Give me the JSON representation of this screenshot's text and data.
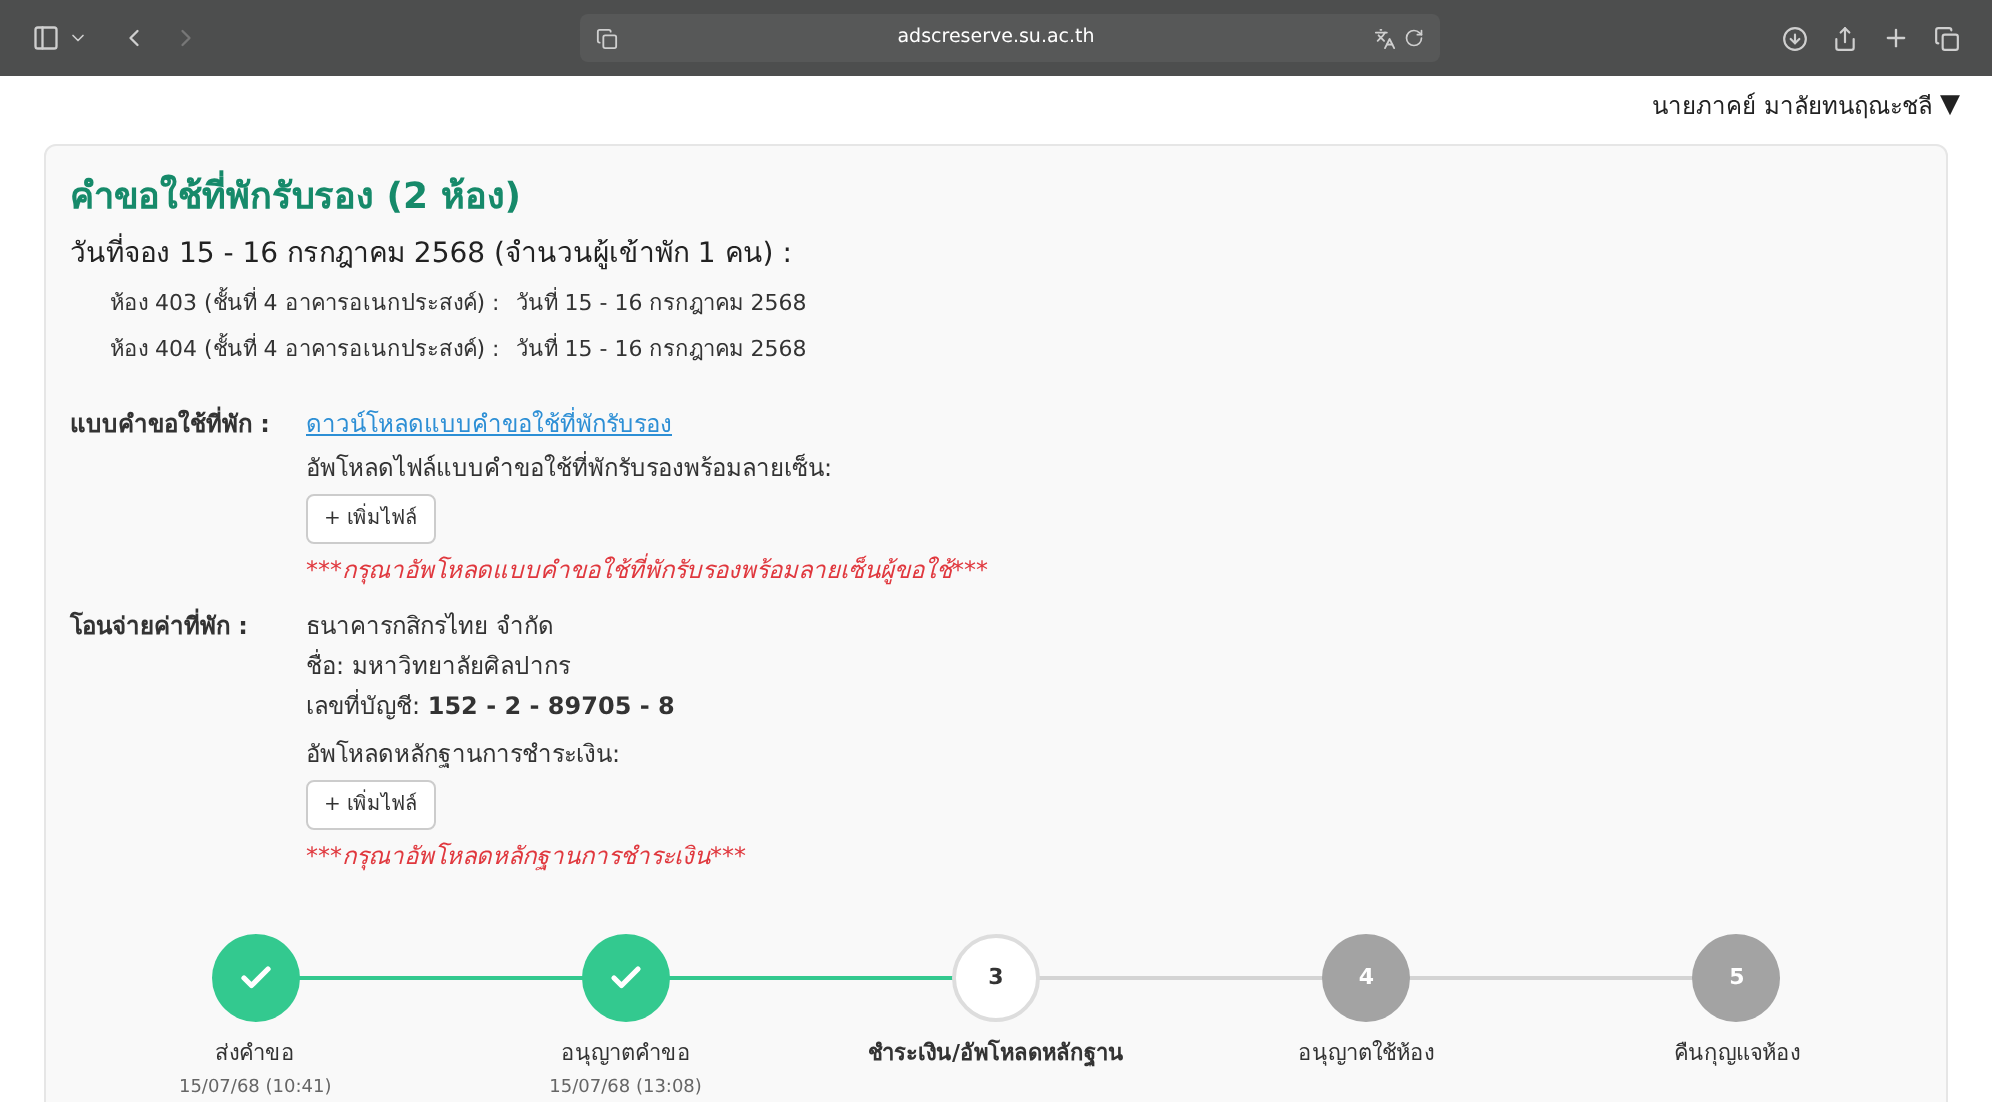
{
  "browser": {
    "url": "adscreserve.su.ac.th"
  },
  "user_menu": {
    "name": "นายภาคย์ มาลัยทนฤณะชลี",
    "caret": "▼"
  },
  "request": {
    "title": "คำขอใช้ที่พักรับรอง (2 ห้อง)",
    "booking_line": "วันที่จอง 15 - 16 กรกฎาคม 2568 (จำนวนผู้เข้าพัก 1 คน) :",
    "rooms": [
      {
        "room": "ห้อง 403 (ชั้นที่ 4 อาคารอเนกประสงค์) :",
        "dates": "วันที่ 15 - 16 กรกฎาคม 2568"
      },
      {
        "room": "ห้อง 404 (ชั้นที่ 4 อาคารอเนกประสงค์) :",
        "dates": "วันที่ 15 - 16 กรกฎาคม 2568"
      }
    ],
    "form_section": {
      "label": "แบบคำขอใช้ที่พัก :",
      "link": "ดาวน์โหลดแบบคำขอใช้ที่พักรับรอง",
      "upload_label": "อัพโหลดไฟล์แบบคำขอใช้ที่พักรับรองพร้อมลายเซ็น:",
      "button": "+ เพิ่มไฟล์",
      "warning": "***กรุณาอัพโหลดแบบคำขอใช้ที่พักรับรองพร้อมลายเซ็นผู้ขอใช้***"
    },
    "payment_section": {
      "label": "โอนจ่ายค่าที่พัก :",
      "bank": "ธนาคารกสิกรไทย จำกัด",
      "account_name": "ชื่อ: มหาวิทยาลัยศิลปากร",
      "account_number": "เลขที่บัญชี: **152 - 2 - 89705 - 8**",
      "upload_label": "อัพโหลดหลักฐานการชำระเงิน:",
      "button": "+ เพิ่มไฟล์",
      "warning": "***กรุณาอัพโหลดหลักฐานการชำระเงิน***"
    }
  },
  "steps": [
    {
      "kind": "done",
      "title": "ส่งคำขอ",
      "time": "15/07/68 (10:41)"
    },
    {
      "kind": "done",
      "title": "อนุญาตคำขอ",
      "time": "15/07/68 (13:08)"
    },
    {
      "kind": "current",
      "number": "3",
      "title": "ชำระเงิน/อัพโหลดหลักฐาน"
    },
    {
      "kind": "pending",
      "number": "4",
      "title": "อนุญาตใช้ห้อง"
    },
    {
      "kind": "pending",
      "number": "5",
      "title": "คืนกุญแจห้อง"
    }
  ]
}
